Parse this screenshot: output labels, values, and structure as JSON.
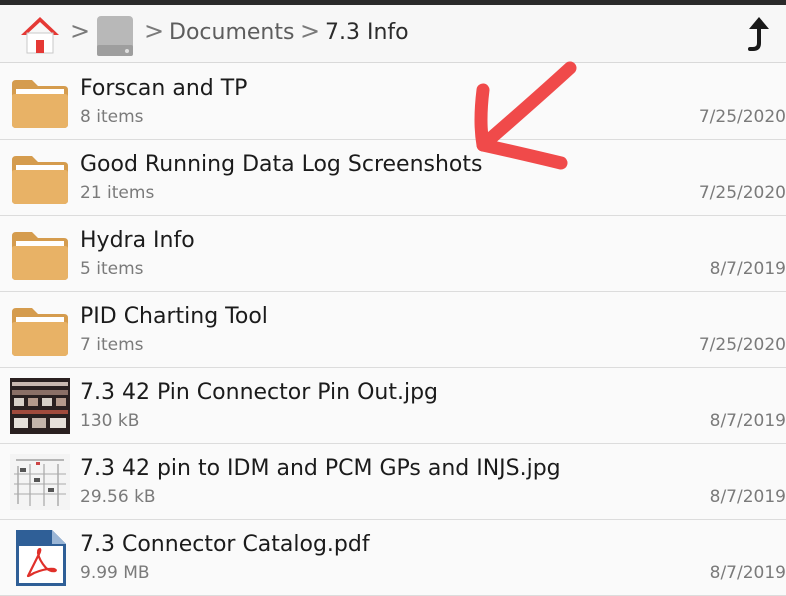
{
  "breadcrumb": {
    "home_icon": "home-icon",
    "drive_icon": "drive-icon",
    "separator": ">",
    "items": [
      "Documents",
      "7.3 Info"
    ]
  },
  "toolbar": {
    "up_icon": "up-arrow-icon"
  },
  "colors": {
    "folder": "#E8B266",
    "folder_tab": "#D59C4E",
    "home_roof": "#E53935",
    "annotation": "#F04A4A",
    "pdf": "#2F5F97"
  },
  "files": [
    {
      "name": "Forscan and TP",
      "detail": "8 items",
      "date": "7/25/2020",
      "kind": "folder"
    },
    {
      "name": "Good Running Data Log Screenshots",
      "detail": "21 items",
      "date": "7/25/2020",
      "kind": "folder"
    },
    {
      "name": "Hydra Info",
      "detail": "5 items",
      "date": "8/7/2019",
      "kind": "folder"
    },
    {
      "name": "PID Charting Tool",
      "detail": "7 items",
      "date": "7/25/2020",
      "kind": "folder"
    },
    {
      "name": "7.3 42 Pin Connector Pin Out.jpg",
      "detail": "130 kB",
      "date": "8/7/2019",
      "kind": "image-dark"
    },
    {
      "name": "7.3 42 pin to IDM and PCM GPs and INJS.jpg",
      "detail": "29.56 kB",
      "date": "8/7/2019",
      "kind": "image-light"
    },
    {
      "name": "7.3 Connector Catalog.pdf",
      "detail": "9.99 MB",
      "date": "8/7/2019",
      "kind": "pdf"
    }
  ]
}
